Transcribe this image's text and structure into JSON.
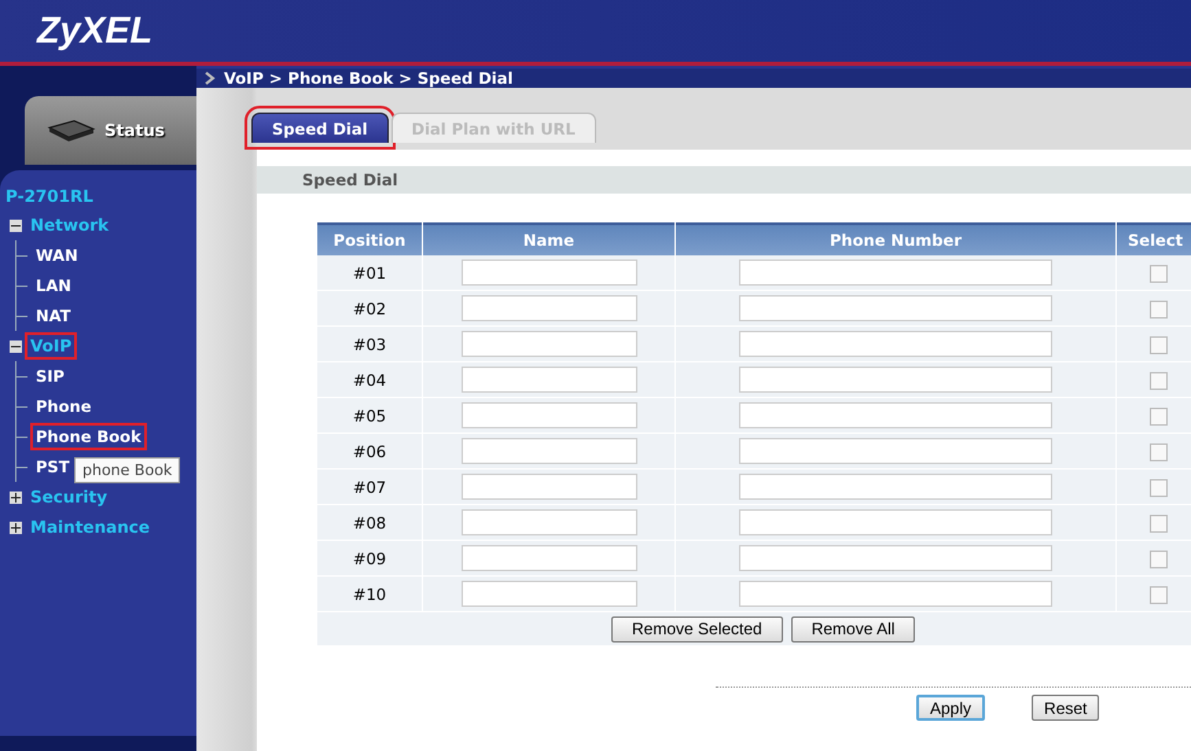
{
  "logo": "ZyXEL",
  "breadcrumb": "VoIP > Phone Book > Speed Dial",
  "status_button": "Status",
  "device": "P-2701RL",
  "tree": [
    {
      "label": "Network",
      "expanded": true,
      "highlighted": false,
      "children": [
        {
          "label": "WAN",
          "highlighted": false
        },
        {
          "label": "LAN",
          "highlighted": false
        },
        {
          "label": "NAT",
          "highlighted": false
        }
      ]
    },
    {
      "label": "VoIP",
      "expanded": true,
      "highlighted": true,
      "children": [
        {
          "label": "SIP",
          "highlighted": false
        },
        {
          "label": "Phone",
          "highlighted": false
        },
        {
          "label": "Phone Book",
          "highlighted": true
        },
        {
          "label": "PST",
          "highlighted": false
        }
      ]
    },
    {
      "label": "Security",
      "expanded": false,
      "highlighted": false
    },
    {
      "label": "Maintenance",
      "expanded": false,
      "highlighted": false
    }
  ],
  "tooltip": "phone Book",
  "tabs": [
    {
      "label": "Speed Dial",
      "selected": true,
      "highlighted": true
    },
    {
      "label": "Dial Plan with URL",
      "selected": false,
      "highlighted": false
    }
  ],
  "section_title": "Speed Dial",
  "table": {
    "columns": [
      "Position",
      "Name",
      "Phone Number",
      "Select"
    ],
    "rows": [
      {
        "position": "#01",
        "checked": false
      },
      {
        "position": "#02",
        "checked": false
      },
      {
        "position": "#03",
        "checked": false
      },
      {
        "position": "#04",
        "checked": false
      },
      {
        "position": "#05",
        "checked": false
      },
      {
        "position": "#06",
        "checked": false
      },
      {
        "position": "#07",
        "checked": false
      },
      {
        "position": "#08",
        "checked": false
      },
      {
        "position": "#09",
        "checked": false
      },
      {
        "position": "#10",
        "checked": false
      }
    ]
  },
  "table_buttons": [
    "Remove Selected",
    "Remove All"
  ],
  "buttons": [
    {
      "label": "Apply",
      "focused": true
    },
    {
      "label": "Reset",
      "focused": false
    }
  ]
}
